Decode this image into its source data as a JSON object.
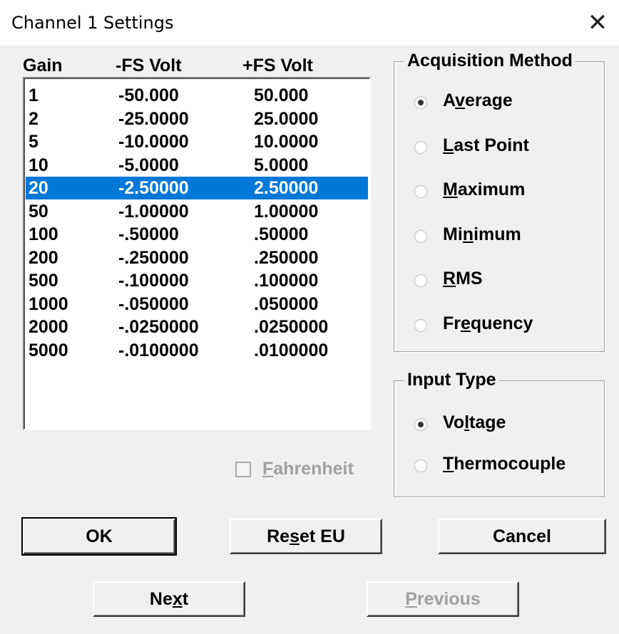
{
  "window": {
    "title": "Channel 1 Settings",
    "close_glyph": "✕"
  },
  "table": {
    "headers": [
      "Gain",
      "-FS Volt",
      "+FS Volt"
    ],
    "rows": [
      [
        "1",
        "-50.000",
        "50.000"
      ],
      [
        "2",
        "-25.0000",
        "25.0000"
      ],
      [
        "5",
        "-10.0000",
        "10.0000"
      ],
      [
        "10",
        "-5.0000",
        "5.0000"
      ],
      [
        "20",
        "-2.50000",
        "2.50000"
      ],
      [
        "50",
        "-1.00000",
        "1.00000"
      ],
      [
        "100",
        "-.50000",
        ".50000"
      ],
      [
        "200",
        "-.250000",
        ".250000"
      ],
      [
        "500",
        "-.100000",
        ".100000"
      ],
      [
        "1000",
        "-.050000",
        ".050000"
      ],
      [
        "2000",
        "-.0250000",
        ".0250000"
      ],
      [
        "5000",
        "-.0100000",
        ".0100000"
      ]
    ],
    "selected_index": 4,
    "selection_color": "#0078d7"
  },
  "acquisition": {
    "legend": "Acquisition Method",
    "options": [
      {
        "pre": "A",
        "u": "v",
        "post": "erage",
        "checked": true
      },
      {
        "pre": "",
        "u": "L",
        "post": "ast Point",
        "checked": false
      },
      {
        "pre": "",
        "u": "M",
        "post": "aximum",
        "checked": false
      },
      {
        "pre": "Mi",
        "u": "n",
        "post": "imum",
        "checked": false
      },
      {
        "pre": "",
        "u": "R",
        "post": "MS",
        "checked": false
      },
      {
        "pre": "Fr",
        "u": "e",
        "post": "quency",
        "checked": false
      }
    ]
  },
  "input_type": {
    "legend": "Input Type",
    "options": [
      {
        "pre": "Vo",
        "u": "l",
        "post": "tage",
        "checked": true
      },
      {
        "pre": "",
        "u": "T",
        "post": "hermocouple",
        "checked": false
      }
    ]
  },
  "fahrenheit": {
    "pre": "",
    "u": "F",
    "post": "ahrenheit",
    "checked": false,
    "disabled": true
  },
  "buttons": {
    "ok": "OK",
    "reset": {
      "pre": "Re",
      "u": "s",
      "post": "et EU"
    },
    "cancel": "Cancel",
    "next": {
      "pre": "Ne",
      "u": "x",
      "post": "t"
    },
    "previous": {
      "pre": "",
      "u": "P",
      "post": "revious"
    }
  }
}
